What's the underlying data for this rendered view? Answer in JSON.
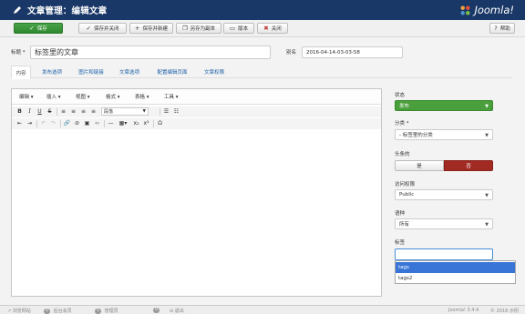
{
  "header": {
    "title": "文章管理：编辑文章",
    "brand": "Joomla!"
  },
  "toolbar": {
    "save": "保存",
    "save_close": "保存并关闭",
    "save_new": "保存并新建",
    "save_copy": "另存为副本",
    "versions": "版本",
    "close": "关闭",
    "help": "帮助"
  },
  "form": {
    "title_label": "标题 *",
    "title_value": "标签里的文章",
    "alias_label": "别名",
    "alias_value": "2016-04-14-03-03-58"
  },
  "tabs": [
    "内容",
    "发布选项",
    "图片和链接",
    "文章选项",
    "配置编辑页面",
    "文章权限"
  ],
  "editor": {
    "menus": [
      "编辑 ▾",
      "插入 ▾",
      "视图 ▾",
      "格式 ▾",
      "表格 ▾",
      "工具 ▾"
    ],
    "paragraph_select": "段落"
  },
  "sidebar": {
    "status_label": "状态",
    "status_value": "发布",
    "category_label": "分类 *",
    "category_value": "- 标签里的分类",
    "featured_label": "头条的",
    "featured_yes": "是",
    "featured_no": "否",
    "access_label": "访问权限",
    "access_value": "Public",
    "language_label": "语种",
    "language_value": "所有",
    "tags_label": "标签",
    "tag_options": [
      "tags",
      "tags2"
    ]
  },
  "footer": {
    "view_site": "浏览网站",
    "visitors_count": "0",
    "visitors_label": "后台会员",
    "admins_count": "1",
    "admins_label": "管理员",
    "messages_count": "0",
    "logout": "退出",
    "version": "Joomla! 3.4.4",
    "copyright": "© 2016 示例"
  },
  "colors": {
    "header": "#1a3867",
    "save": "#3c963c",
    "status": "#4a9e3b",
    "no": "#a12a22",
    "highlight": "#3875d7"
  }
}
